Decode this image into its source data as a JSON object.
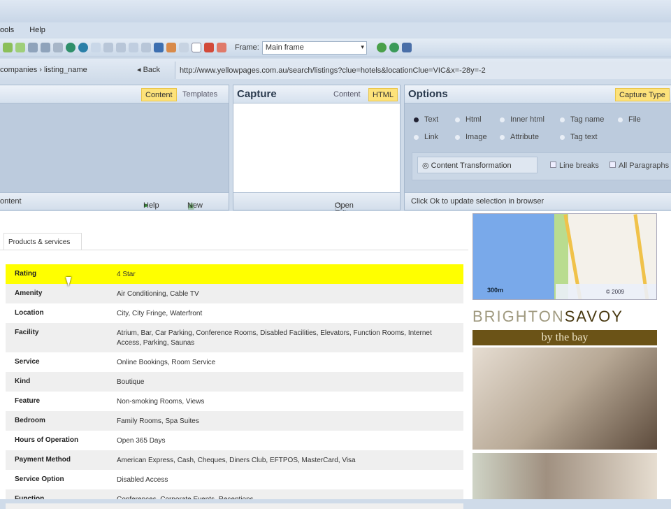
{
  "menu": [
    "ools",
    "Help"
  ],
  "toolbar": {
    "frame_label": "Frame:",
    "frame_value": "Main frame"
  },
  "address": {
    "crumb": "companies  ›  listing_name",
    "back": "◂ Back",
    "url": "http://www.yellowpages.com.au/search/listings?clue=hotels&locationClue=VIC&x=-28y=-2"
  },
  "left_panel": {
    "tabs": [
      "Content",
      "Templates"
    ],
    "footer_left": "ontent",
    "help": "Help",
    "new": "New"
  },
  "capture": {
    "title": "Capture",
    "tabs": [
      "Content",
      "HTML"
    ],
    "open_editor": "Open Editor"
  },
  "options": {
    "title": "Options",
    "capture_type": "Capture Type",
    "radios_row1": [
      "Text",
      "Html",
      "Inner html",
      "Tag name",
      "File"
    ],
    "radios_row2": [
      "Link",
      "Image",
      "Attribute",
      "Tag text"
    ],
    "content_transformation": "Content Transformation",
    "line_breaks": "Line breaks",
    "all_paragraphs": "All Paragraphs",
    "status": "Click Ok to update selection in browser"
  },
  "page": {
    "tab": "Products & services",
    "rows": [
      {
        "k": "Rating",
        "v": "4 Star"
      },
      {
        "k": "Amenity",
        "v": "Air Conditioning, Cable TV"
      },
      {
        "k": "Location",
        "v": "City, City Fringe, Waterfront"
      },
      {
        "k": "Facility",
        "v": "Atrium, Bar, Car Parking, Conference Rooms, Disabled Facilities, Elevators, Function Rooms, Internet Access, Parking, Saunas"
      },
      {
        "k": "Service",
        "v": "Online Bookings, Room Service"
      },
      {
        "k": "Kind",
        "v": "Boutique"
      },
      {
        "k": "Feature",
        "v": "Non-smoking Rooms, Views"
      },
      {
        "k": "Bedroom",
        "v": "Family Rooms, Spa Suites"
      },
      {
        "k": "Hours of Operation",
        "v": "Open 365 Days"
      },
      {
        "k": "Payment Method",
        "v": "American Express, Cash, Cheques, Diners Club, EFTPOS, MasterCard, Visa"
      },
      {
        "k": "Service Option",
        "v": "Disabled Access"
      },
      {
        "k": "Function",
        "v": "Conferences, Corporate Events, Receptions"
      }
    ]
  },
  "ad": {
    "map_scale": "300m",
    "map_copy": "© 2009",
    "logo_light": "BRIGHTON",
    "logo_dark": "SAVOY",
    "tagline": "by the bay"
  },
  "colors": {
    "highlight": "#ffff00",
    "tab_active": "#fde27a"
  }
}
